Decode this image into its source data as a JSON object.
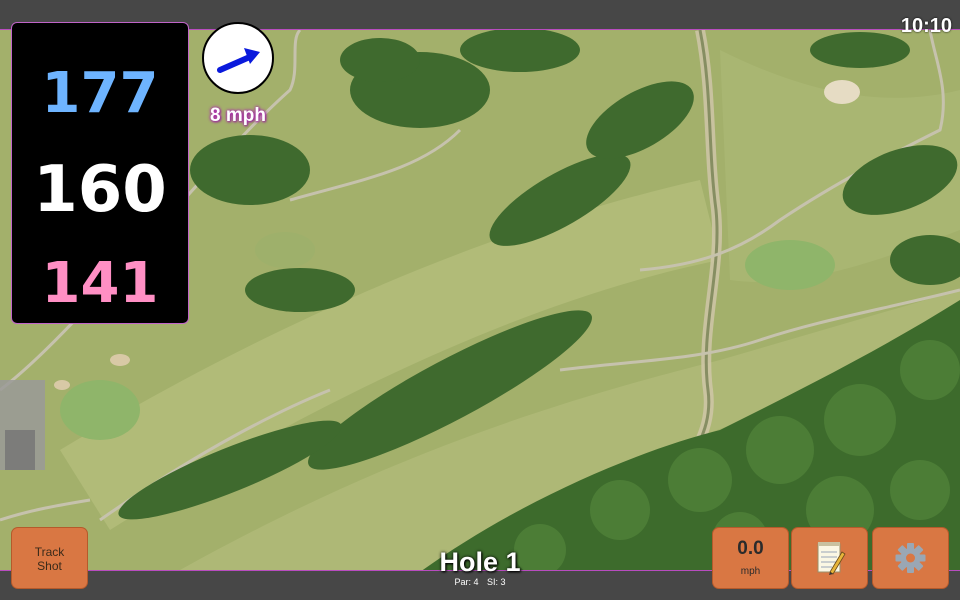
{
  "status": {
    "time": "10:10"
  },
  "distances": {
    "back": "177",
    "middle": "160",
    "front": "141"
  },
  "wind": {
    "speed_label": "8 mph",
    "icon": "wind-direction-arrow-icon"
  },
  "hole": {
    "title": "Hole 1",
    "par_label": "Par: 4",
    "si_label": "SI: 3"
  },
  "buttons": {
    "track_shot_line1": "Track",
    "track_shot_line2": "Shot",
    "speed_value": "0.0",
    "speed_unit": "mph",
    "notes_icon": "notepad-icon",
    "settings_icon": "gear-icon"
  },
  "colors": {
    "back": "#6eb4ff",
    "middle": "#ffffff",
    "front": "#ff8fc4",
    "button": "#d97743",
    "accent": "#c064c8"
  }
}
